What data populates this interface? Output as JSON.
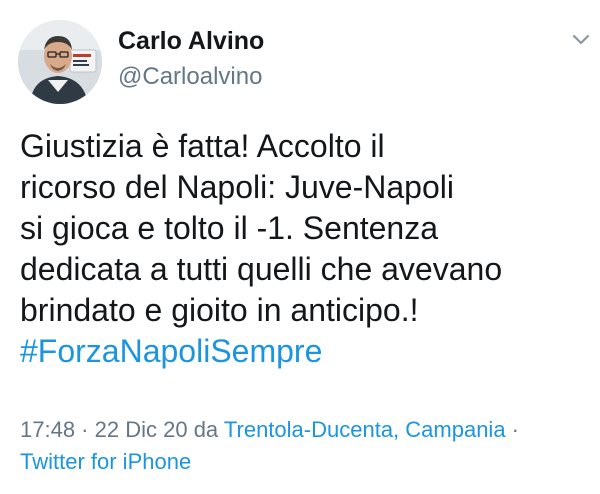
{
  "author": {
    "name": "Carlo Alvino",
    "handle": "@Carloalvino",
    "avatar_icon": "profile-photo"
  },
  "menu_icon": "chevron-down-icon",
  "tweet": {
    "lines": [
      "Giustizia è fatta! Accolto il",
      "ricorso del Napoli: Juve-Napoli",
      "si gioca e tolto il -1. Sentenza",
      "dedicata a tutti quelli che avevano",
      "brindato e gioito in anticipo.!"
    ],
    "hashtag": "#ForzaNapoliSempre"
  },
  "meta": {
    "time": "17:48",
    "sep1": " · ",
    "date": "22 Dic 20",
    "da": " da ",
    "location": "Trentola-Ducenta, Campania",
    "sep2": " ·",
    "source": "Twitter for iPhone"
  },
  "colors": {
    "link": "#1b95e0",
    "secondary_text": "#657786",
    "primary_text": "#14171a"
  }
}
